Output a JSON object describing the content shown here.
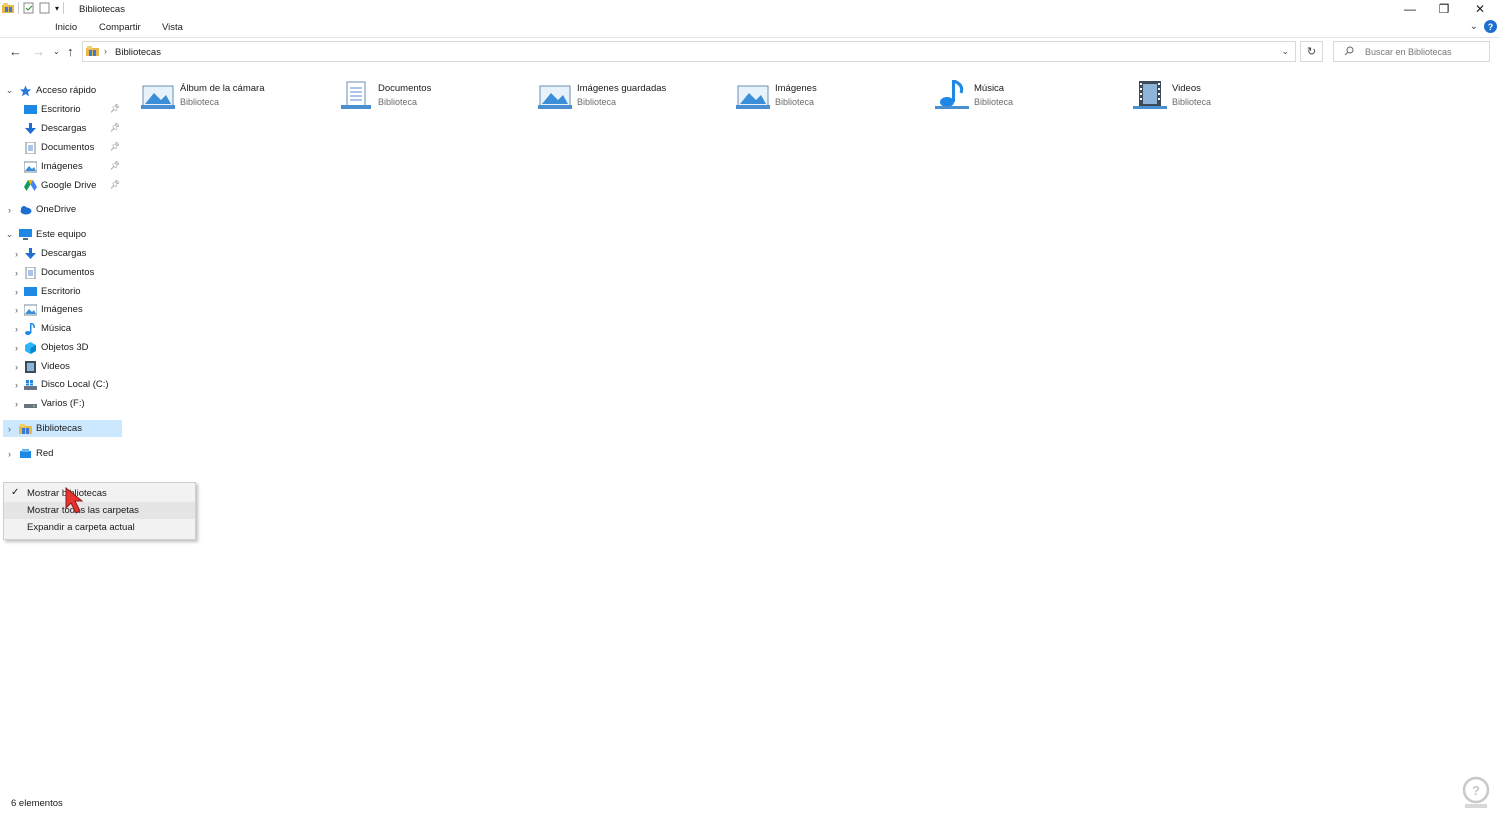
{
  "window": {
    "title": "Bibliotecas",
    "minimize": "—",
    "maximize": "❐",
    "close": "✕",
    "help": "?"
  },
  "ribbon": {
    "tabs": [
      "Inicio",
      "Compartir",
      "Vista"
    ]
  },
  "address": {
    "path": "Bibliotecas",
    "search_placeholder": "Buscar en Bibliotecas"
  },
  "nav": {
    "quick_access": {
      "label": "Acceso rápido",
      "items": [
        "Escritorio",
        "Descargas",
        "Documentos",
        "Imágenes",
        "Google Drive"
      ]
    },
    "onedrive": "OneDrive",
    "this_pc": {
      "label": "Este equipo",
      "items": [
        "Descargas",
        "Documentos",
        "Escritorio",
        "Imágenes",
        "Música",
        "Objetos 3D",
        "Videos",
        "Disco Local (C:)",
        "Varios (F:)"
      ]
    },
    "libraries": "Bibliotecas",
    "network": "Red"
  },
  "libraries": [
    {
      "name": "Álbum de la cámara",
      "type": "Biblioteca",
      "icon": "camera-roll-library-icon"
    },
    {
      "name": "Documentos",
      "type": "Biblioteca",
      "icon": "documents-library-icon"
    },
    {
      "name": "Imágenes guardadas",
      "type": "Biblioteca",
      "icon": "saved-pictures-library-icon"
    },
    {
      "name": "Imágenes",
      "type": "Biblioteca",
      "icon": "pictures-library-icon"
    },
    {
      "name": "Música",
      "type": "Biblioteca",
      "icon": "music-library-icon"
    },
    {
      "name": "Videos",
      "type": "Biblioteca",
      "icon": "videos-library-icon"
    }
  ],
  "context_menu": {
    "items": [
      "Mostrar bibliotecas",
      "Mostrar todas las carpetas",
      "Expandir a carpeta actual"
    ],
    "checked_index": 0
  },
  "status": {
    "count": "6 elementos"
  },
  "colors": {
    "selection": "#cce8ff",
    "accent": "#1f6fd1",
    "cursor": "#e8322f"
  }
}
